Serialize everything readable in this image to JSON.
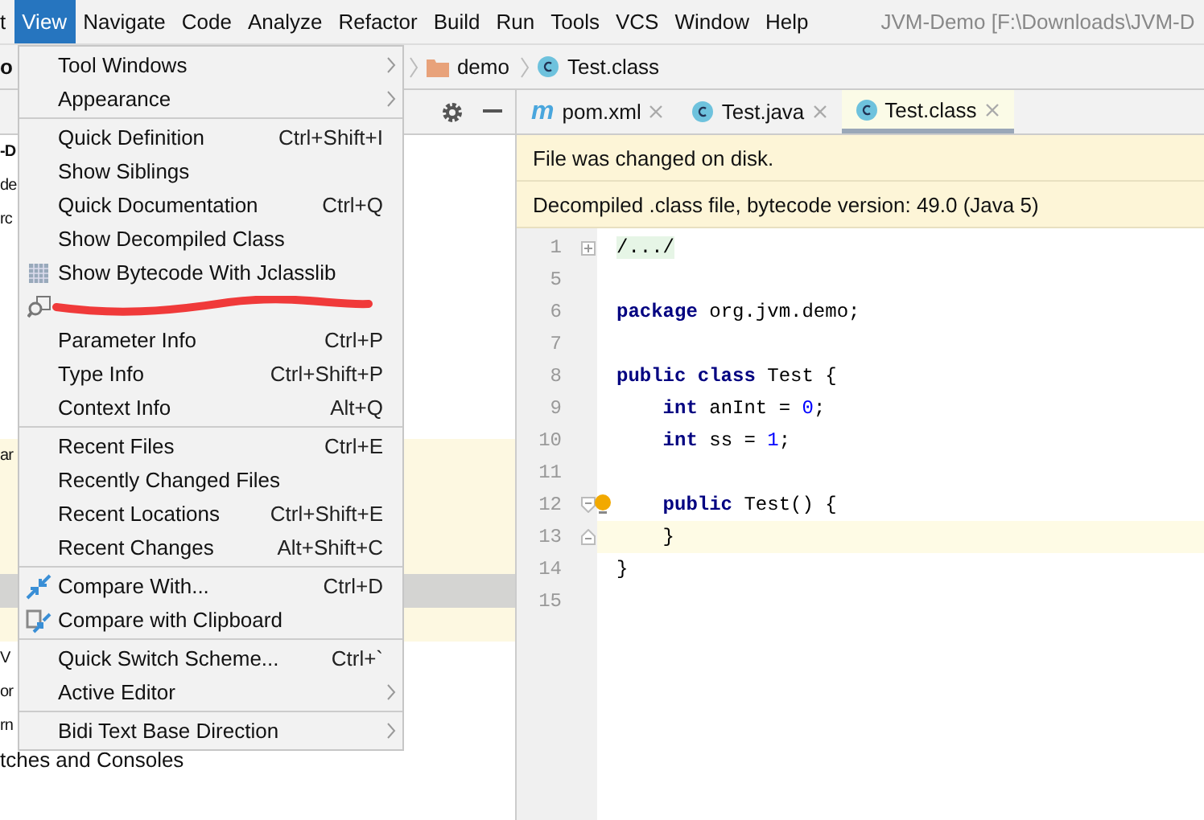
{
  "menu_bar": {
    "items": [
      {
        "label": "t",
        "selected": false
      },
      {
        "label": "View",
        "selected": true
      },
      {
        "label": "Navigate",
        "selected": false
      },
      {
        "label": "Code",
        "selected": false
      },
      {
        "label": "Analyze",
        "selected": false
      },
      {
        "label": "Refactor",
        "selected": false
      },
      {
        "label": "Build",
        "selected": false
      },
      {
        "label": "Run",
        "selected": false
      },
      {
        "label": "Tools",
        "selected": false
      },
      {
        "label": "VCS",
        "selected": false
      },
      {
        "label": "Window",
        "selected": false
      },
      {
        "label": "Help",
        "selected": false
      }
    ],
    "title": "JVM-Demo [F:\\Downloads\\JVM-D"
  },
  "breadcrumb": {
    "project": "o",
    "items": [
      {
        "label": "demo",
        "kind": "folder"
      },
      {
        "label": "Test.class",
        "kind": "class"
      }
    ]
  },
  "project_panel": {
    "rows": [
      {
        "text": "-D",
        "highlighted": false,
        "selected": false
      },
      {
        "text": "de",
        "highlighted": false,
        "selected": false
      },
      {
        "text": "rc",
        "highlighted": false,
        "selected": false
      },
      {
        "highlighted": false,
        "selected": false
      },
      {
        "highlighted": false,
        "selected": false
      },
      {
        "highlighted": false,
        "selected": false
      },
      {
        "highlighted": false,
        "selected": false
      },
      {
        "highlighted": false,
        "selected": false
      },
      {
        "highlighted": false,
        "selected": false
      },
      {
        "text": "ar",
        "highlighted": true,
        "selected": false
      },
      {
        "highlighted": true,
        "selected": false
      },
      {
        "highlighted": true,
        "selected": false
      },
      {
        "highlighted": true,
        "selected": false
      },
      {
        "highlighted": true,
        "selected": true
      },
      {
        "highlighted": true,
        "selected": false
      },
      {
        "text": "V",
        "highlighted": false,
        "selected": false
      },
      {
        "text": "or",
        "highlighted": false,
        "selected": false
      },
      {
        "text": "rn",
        "highlighted": false,
        "selected": false
      },
      {
        "text": "tches and Consoles",
        "highlighted": false,
        "selected": false
      }
    ]
  },
  "tabs": [
    {
      "label": "pom.xml",
      "kind": "maven",
      "glyph": "m",
      "selected": false
    },
    {
      "label": "Test.java",
      "kind": "class",
      "selected": false
    },
    {
      "label": "Test.class",
      "kind": "class",
      "selected": true
    }
  ],
  "notifications": [
    "File was changed on disk.",
    "Decompiled .class file, bytecode version: 49.0 (Java 5)"
  ],
  "code": [
    {
      "number": "1",
      "kind": "fold-expand",
      "folded": true,
      "current": false,
      "tokens": [
        {
          "text": "/.../",
          "kind": "plain"
        }
      ]
    },
    {
      "number": "5",
      "current": false
    },
    {
      "number": "6",
      "current": false,
      "tokens": [
        {
          "text": "package",
          "kind": "keyword"
        },
        {
          "text": " org.jvm.demo;",
          "kind": "plain"
        }
      ]
    },
    {
      "number": "7",
      "current": false
    },
    {
      "number": "8",
      "current": false,
      "tokens": [
        {
          "text": "public class",
          "kind": "keyword"
        },
        {
          "text": " Test {",
          "kind": "plain"
        }
      ]
    },
    {
      "number": "9",
      "current": false,
      "tokens": [
        {
          "text": "    int",
          "kind": "keyword"
        },
        {
          "text": " anInt = ",
          "kind": "plain"
        },
        {
          "text": "0",
          "kind": "number"
        },
        {
          "text": ";",
          "kind": "plain"
        }
      ]
    },
    {
      "number": "10",
      "current": false,
      "tokens": [
        {
          "text": "    int",
          "kind": "keyword"
        },
        {
          "text": " ss = ",
          "kind": "plain"
        },
        {
          "text": "1",
          "kind": "number"
        },
        {
          "text": ";",
          "kind": "plain"
        }
      ]
    },
    {
      "number": "11",
      "current": false
    },
    {
      "number": "12",
      "kind": "fold-start",
      "bulb": true,
      "current": false,
      "tokens": [
        {
          "text": "    public",
          "kind": "keyword"
        },
        {
          "text": " Test() {",
          "kind": "plain"
        }
      ]
    },
    {
      "number": "13",
      "kind": "fold-end",
      "current": true,
      "tokens": [
        {
          "text": "    }",
          "kind": "plain"
        }
      ]
    },
    {
      "number": "14",
      "current": false,
      "tokens": [
        {
          "text": "}",
          "kind": "plain"
        }
      ]
    },
    {
      "number": "15",
      "current": false
    }
  ],
  "view_menu": {
    "items": [
      {
        "kind": "item",
        "label": "Tool Windows",
        "submenu": true
      },
      {
        "kind": "item",
        "label": "Appearance",
        "submenu": true
      },
      {
        "kind": "separator"
      },
      {
        "kind": "item",
        "label": "Quick Definition",
        "shortcut": "Ctrl+Shift+I"
      },
      {
        "kind": "item",
        "label": "Show Siblings"
      },
      {
        "kind": "item",
        "label": "Quick Documentation",
        "shortcut": "Ctrl+Q"
      },
      {
        "kind": "item",
        "label": "Show Decompiled Class"
      },
      {
        "kind": "grid",
        "label": "Show Bytecode With Jclasslib"
      },
      {
        "kind": "scribbled"
      },
      {
        "kind": "item",
        "label": "Parameter Info",
        "shortcut": "Ctrl+P"
      },
      {
        "kind": "item",
        "label": "Type Info",
        "shortcut": "Ctrl+Shift+P"
      },
      {
        "kind": "item",
        "label": "Context Info",
        "shortcut": "Alt+Q"
      },
      {
        "kind": "separator"
      },
      {
        "kind": "item",
        "label": "Recent Files",
        "shortcut": "Ctrl+E"
      },
      {
        "kind": "item",
        "label": "Recently Changed Files"
      },
      {
        "kind": "item",
        "label": "Recent Locations",
        "shortcut": "Ctrl+Shift+E"
      },
      {
        "kind": "item",
        "label": "Recent Changes",
        "shortcut": "Alt+Shift+C"
      },
      {
        "kind": "separator"
      },
      {
        "kind": "compare",
        "label": "Compare With...",
        "shortcut": "Ctrl+D"
      },
      {
        "kind": "clipboard",
        "label": "Compare with Clipboard"
      },
      {
        "kind": "separator"
      },
      {
        "kind": "item",
        "label": "Quick Switch Scheme...",
        "shortcut": "Ctrl+`"
      },
      {
        "kind": "item",
        "label": "Active Editor",
        "submenu": true
      },
      {
        "kind": "separator"
      },
      {
        "kind": "item",
        "label": "Bidi Text Base Direction",
        "submenu": true
      }
    ]
  }
}
